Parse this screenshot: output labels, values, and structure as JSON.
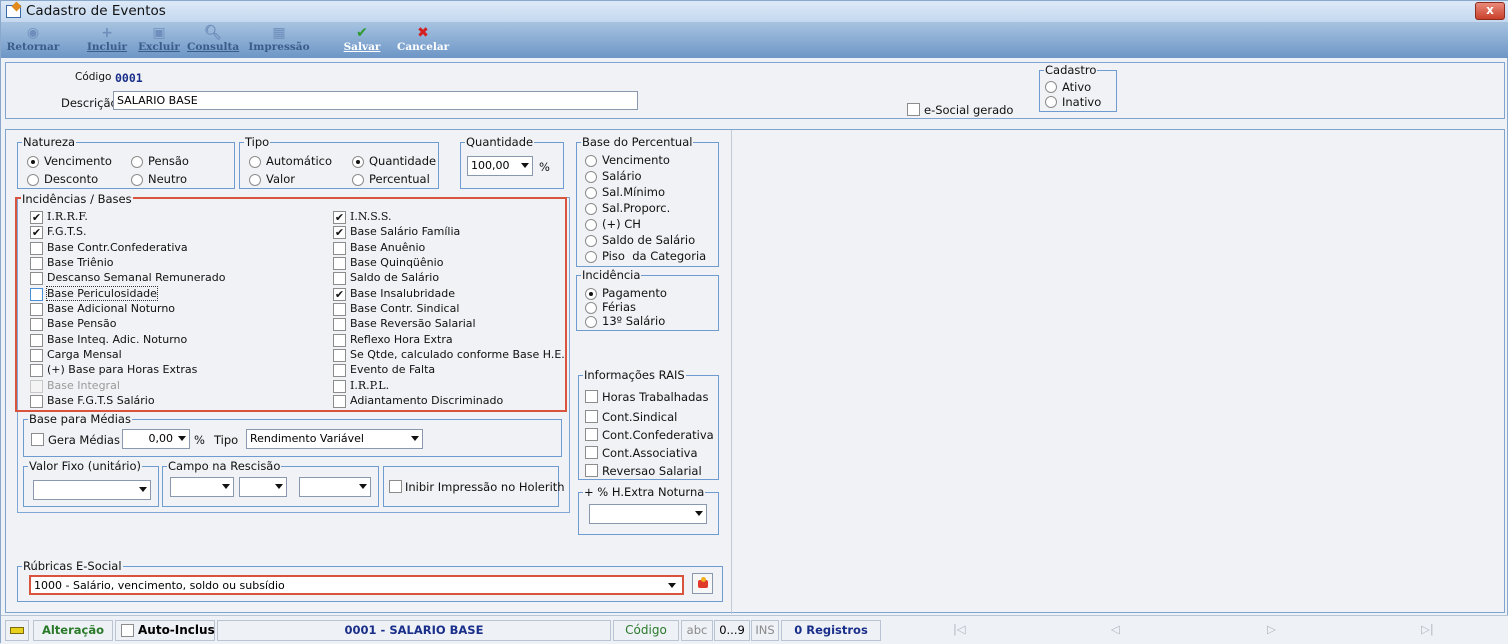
{
  "window": {
    "title": "Cadastro de Eventos",
    "close": "x"
  },
  "toolbar": [
    {
      "label": "Retornar",
      "icon": "back-circle-icon",
      "glyph": "◉",
      "enabled": false
    },
    {
      "label": "Incluir",
      "icon": "plus-icon",
      "glyph": "+",
      "enabled": false
    },
    {
      "label": "Excluir",
      "icon": "delete-icon",
      "glyph": "▣",
      "enabled": false
    },
    {
      "label": "Consulta",
      "icon": "magnifier-icon",
      "glyph": "🔍︎",
      "enabled": false
    },
    {
      "label": "Impressão",
      "icon": "printer-icon",
      "glyph": "▦",
      "enabled": false
    },
    {
      "label": "Salvar",
      "icon": "check-icon",
      "glyph": "✔",
      "enabled": true
    },
    {
      "label": "Cancelar",
      "icon": "red-x-icon",
      "glyph": "✖",
      "enabled": true
    }
  ],
  "header": {
    "codigo_label": "Código",
    "codigo_value": "0001",
    "descricao_label": "Descrição",
    "descricao_value": "SALARIO BASE",
    "esocial_label": "e-Social gerado",
    "cadastro_title": "Cadastro",
    "cadastro_options": [
      "Ativo",
      "Inativo"
    ]
  },
  "natureza": {
    "title": "Natureza",
    "options": [
      "Vencimento",
      "Pensão",
      "Desconto",
      "Neutro"
    ],
    "selected": "Vencimento"
  },
  "tipo": {
    "title": "Tipo",
    "options": [
      "Automático",
      "Quantidade",
      "Valor",
      "Percentual"
    ],
    "selected": "Quantidade"
  },
  "quantidade": {
    "title": "Quantidade",
    "value": "100,00",
    "unit": "%"
  },
  "base_percentual": {
    "title": "Base do Percentual",
    "options": [
      "Vencimento",
      "Salário",
      "Sal.Mínimo",
      "Sal.Proporc.",
      "(+) CH",
      "Saldo de Salário",
      "Piso  da Categoria"
    ]
  },
  "incidencia": {
    "title": "Incidência",
    "options": [
      "Pagamento",
      "Férias",
      "13º Salário"
    ],
    "selected": "Pagamento"
  },
  "incidencias_bases": {
    "title": "Incidências / Bases",
    "left": [
      {
        "label": "I.R.R.F.",
        "checked": true,
        "serif": true
      },
      {
        "label": "F.G.T.S.",
        "checked": true,
        "serif": false
      },
      {
        "label": "Base Contr.Confederativa",
        "checked": false,
        "serif": false
      },
      {
        "label": "Base Triênio",
        "checked": false,
        "serif": false
      },
      {
        "label": "Descanso Semanal Remunerado",
        "checked": false,
        "serif": false
      },
      {
        "label": "Base Periculosidade",
        "checked": false,
        "serif": false,
        "focused": true
      },
      {
        "label": "Base Adicional Noturno",
        "checked": false,
        "serif": false
      },
      {
        "label": "Base Pensão",
        "checked": false,
        "serif": false
      },
      {
        "label": "Base Inteq. Adic. Noturno",
        "checked": false,
        "serif": false
      },
      {
        "label": "Carga Mensal",
        "checked": false,
        "serif": false
      },
      {
        "label": "(+) Base para Horas Extras",
        "checked": false,
        "serif": false
      },
      {
        "label": "Base Integral",
        "checked": false,
        "serif": false,
        "disabled": true
      },
      {
        "label": "Base F.G.T.S Salário",
        "checked": false,
        "serif": false
      }
    ],
    "right": [
      {
        "label": "I.N.S.S.",
        "checked": true,
        "serif": true
      },
      {
        "label": "Base Salário Família",
        "checked": true,
        "serif": false
      },
      {
        "label": "Base Anuênio",
        "checked": false,
        "serif": false
      },
      {
        "label": "Base Quinqüênio",
        "checked": false,
        "serif": false
      },
      {
        "label": "Saldo de Salário",
        "checked": false,
        "serif": false
      },
      {
        "label": "Base Insalubridade",
        "checked": true,
        "serif": false
      },
      {
        "label": "Base Contr. Sindical",
        "checked": false,
        "serif": false
      },
      {
        "label": "Base Reversão Salarial",
        "checked": false,
        "serif": false
      },
      {
        "label": "Reflexo Hora Extra",
        "checked": false,
        "serif": false
      },
      {
        "label": "Se Qtde, calculado conforme Base H.E.",
        "checked": false,
        "serif": false
      },
      {
        "label": "Evento de Falta",
        "checked": false,
        "serif": false
      },
      {
        "label": "I.R.P.L.",
        "checked": false,
        "serif": true
      },
      {
        "label": "Adiantamento Discriminado",
        "checked": false,
        "serif": false
      }
    ]
  },
  "base_medias": {
    "title": "Base para Médias",
    "gera_label": "Gera Médias",
    "gera_value": "0,00",
    "unit": "%",
    "tipo_label": "Tipo",
    "tipo_value": "Rendimento Variável"
  },
  "valor_fixo": {
    "title": "Valor Fixo (unitário)"
  },
  "campo_rescisao": {
    "title": "Campo na Rescisão"
  },
  "inibir_label": "Inibir Impressão no Holerith",
  "rais": {
    "title": "Informações RAIS",
    "items": [
      "Horas Trabalhadas",
      "Cont.Sindical",
      "Cont.Confederativa",
      "Cont.Associativa",
      "Reversao Salarial"
    ]
  },
  "hextra": {
    "title": "+ % H.Extra Noturna"
  },
  "rubricas": {
    "title": "Rúbricas E-Social",
    "value": "1000 - Salário, vencimento, soldo ou subsídio"
  },
  "status": {
    "mode": "Alteração",
    "auto_label": "Auto-Inclus",
    "record": "0001 - SALARIO BASE",
    "field": "Código",
    "abc": "abc",
    "range": "0...9",
    "ins": "INS",
    "registros": "0 Registros",
    "nav": [
      "|◁",
      "◁",
      "▷",
      "▷|"
    ]
  }
}
